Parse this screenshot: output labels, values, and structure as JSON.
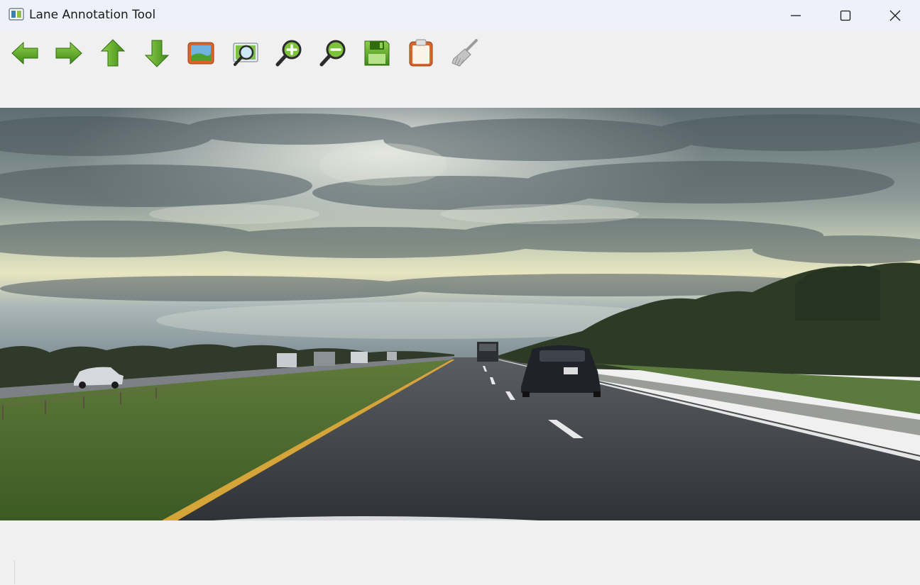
{
  "window": {
    "title": "Lane Annotation Tool",
    "controls": [
      "minimize",
      "maximize",
      "close"
    ]
  },
  "toolbar": {
    "tools": [
      {
        "name": "previous",
        "icon": "arrow-left-icon"
      },
      {
        "name": "next",
        "icon": "arrow-right-icon"
      },
      {
        "name": "up",
        "icon": "arrow-up-icon"
      },
      {
        "name": "down",
        "icon": "arrow-down-icon"
      },
      {
        "name": "open-image",
        "icon": "image-icon"
      },
      {
        "name": "fit-view",
        "icon": "zoom-fit-icon"
      },
      {
        "name": "zoom-in",
        "icon": "zoom-in-icon"
      },
      {
        "name": "zoom-out",
        "icon": "zoom-out-icon"
      },
      {
        "name": "save",
        "icon": "save-icon"
      },
      {
        "name": "clipboard",
        "icon": "clipboard-icon"
      },
      {
        "name": "clear",
        "icon": "broom-icon"
      }
    ]
  },
  "canvas": {
    "content": "road-scene-image"
  },
  "colors": {
    "titlebar": "#eef1f9",
    "background": "#f0f0f0",
    "icon_green": "#4f9a1e",
    "icon_green_light": "#7cc23a",
    "icon_orange": "#d8652a"
  }
}
